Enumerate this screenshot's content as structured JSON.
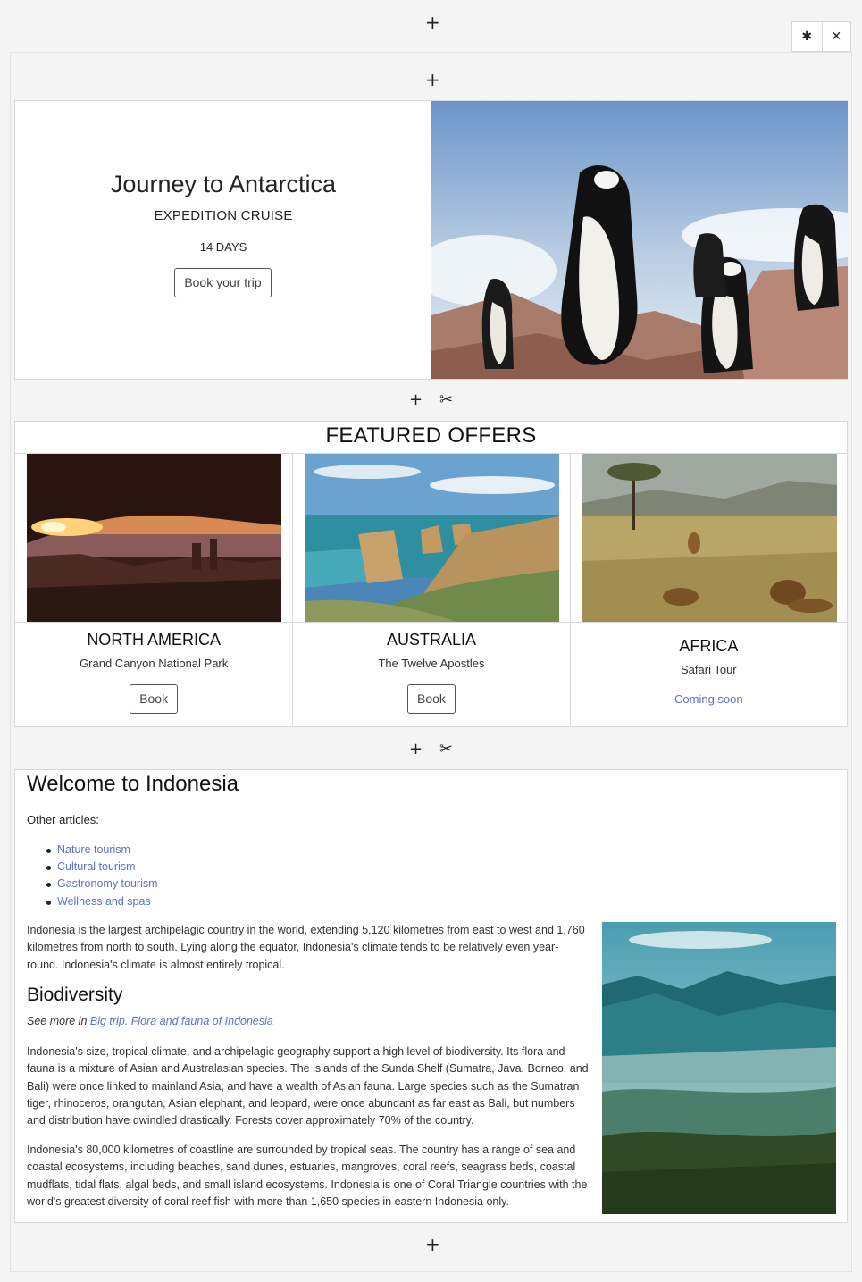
{
  "editor": {
    "top_add_icon": "+",
    "bottom_add_icon": "+",
    "toolbox": {
      "settings_icon": "✱",
      "close_icon": "✕"
    },
    "block_add_icon": "+",
    "block_cut_icon": "✂"
  },
  "hero": {
    "title": "Journey to Antarctica",
    "subtitle": "EXPEDITION CRUISE",
    "duration": "14 DAYS",
    "button_label": "Book your trip"
  },
  "offers": {
    "heading": "FEATURED OFFERS",
    "cards": [
      {
        "title": "NORTH AMERICA",
        "subtitle": "Grand Canyon National Park",
        "button_label": "Book"
      },
      {
        "title": "AUSTRALIA",
        "subtitle": "The Twelve Apostles",
        "button_label": "Book"
      },
      {
        "title": "AFRICA",
        "subtitle": "Safari Tour",
        "status_label": "Coming soon"
      }
    ]
  },
  "article": {
    "title": "Welcome to Indonesia",
    "other_articles_label": "Other articles:",
    "links": [
      "Nature tourism",
      "Cultural tourism",
      "Gastronomy tourism",
      "Wellness and spas"
    ],
    "intro": "Indonesia is the largest archipelagic country in the world, extending 5,120 kilometres from east to west and 1,760 kilometres from north to south. Lying along the equator, Indonesia's climate tends to be relatively even year-round. Indonesia's climate is almost entirely tropical.",
    "section_title": "Biodiversity",
    "see_more_prefix": "See more in ",
    "see_more_link": "Big trip. Flora and fauna of Indonesia",
    "para1": "Indonesia's size, tropical climate, and archipelagic geography support a high level of biodiversity. Its flora and fauna is a mixture of Asian and Australasian species. The islands of the Sunda Shelf (Sumatra, Java, Borneo, and Bali) were once linked to mainland Asia, and have a wealth of Asian fauna. Large species such as the Sumatran tiger, rhinoceros, orangutan, Asian elephant, and leopard, were once abundant as far east as Bali, but numbers and distribution have dwindled drastically. Forests cover approximately 70% of the country.",
    "para2": "Indonesia's 80,000 kilometres of coastline are surrounded by tropical seas. The country has a range of sea and coastal ecosystems, including beaches, sand dunes, estuaries, mangroves, coral reefs, seagrass beds, coastal mudflats, tidal flats, algal beds, and small island ecosystems. Indonesia is one of Coral Triangle countries with the world's greatest diversity of coral reef fish with more than 1,650 species in eastern Indonesia only."
  },
  "colors": {
    "link": "#5b6fd0",
    "border": "#d8d8d8",
    "background": "#f4f4f4"
  }
}
